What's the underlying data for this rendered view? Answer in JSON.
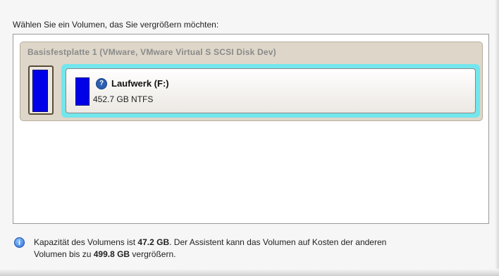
{
  "prompt": "Wählen Sie ein Volumen, das Sie vergrößern möchten:",
  "disk": {
    "title": "Basisfestplatte 1 (VMware, VMware Virtual S SCSI Disk Dev)",
    "icon": "disk-icon"
  },
  "volume": {
    "name": "Laufwerk (F:)",
    "info": "452.7 GB NTFS",
    "icon": "help-icon"
  },
  "info": {
    "icon": "info-icon",
    "part1": "Kapazität des Volumens ist ",
    "capacity": "47.2 GB",
    "part2": ". Der Assistent kann das Volumen auf Kosten der anderen",
    "part3": "Volumen bis zu ",
    "max": "499.8 GB",
    "part4": " vergrößern."
  },
  "colors": {
    "volume_bar": "#0000e8",
    "selection_border": "#72e6ec",
    "disk_group_bg": "#ddd6c9"
  }
}
